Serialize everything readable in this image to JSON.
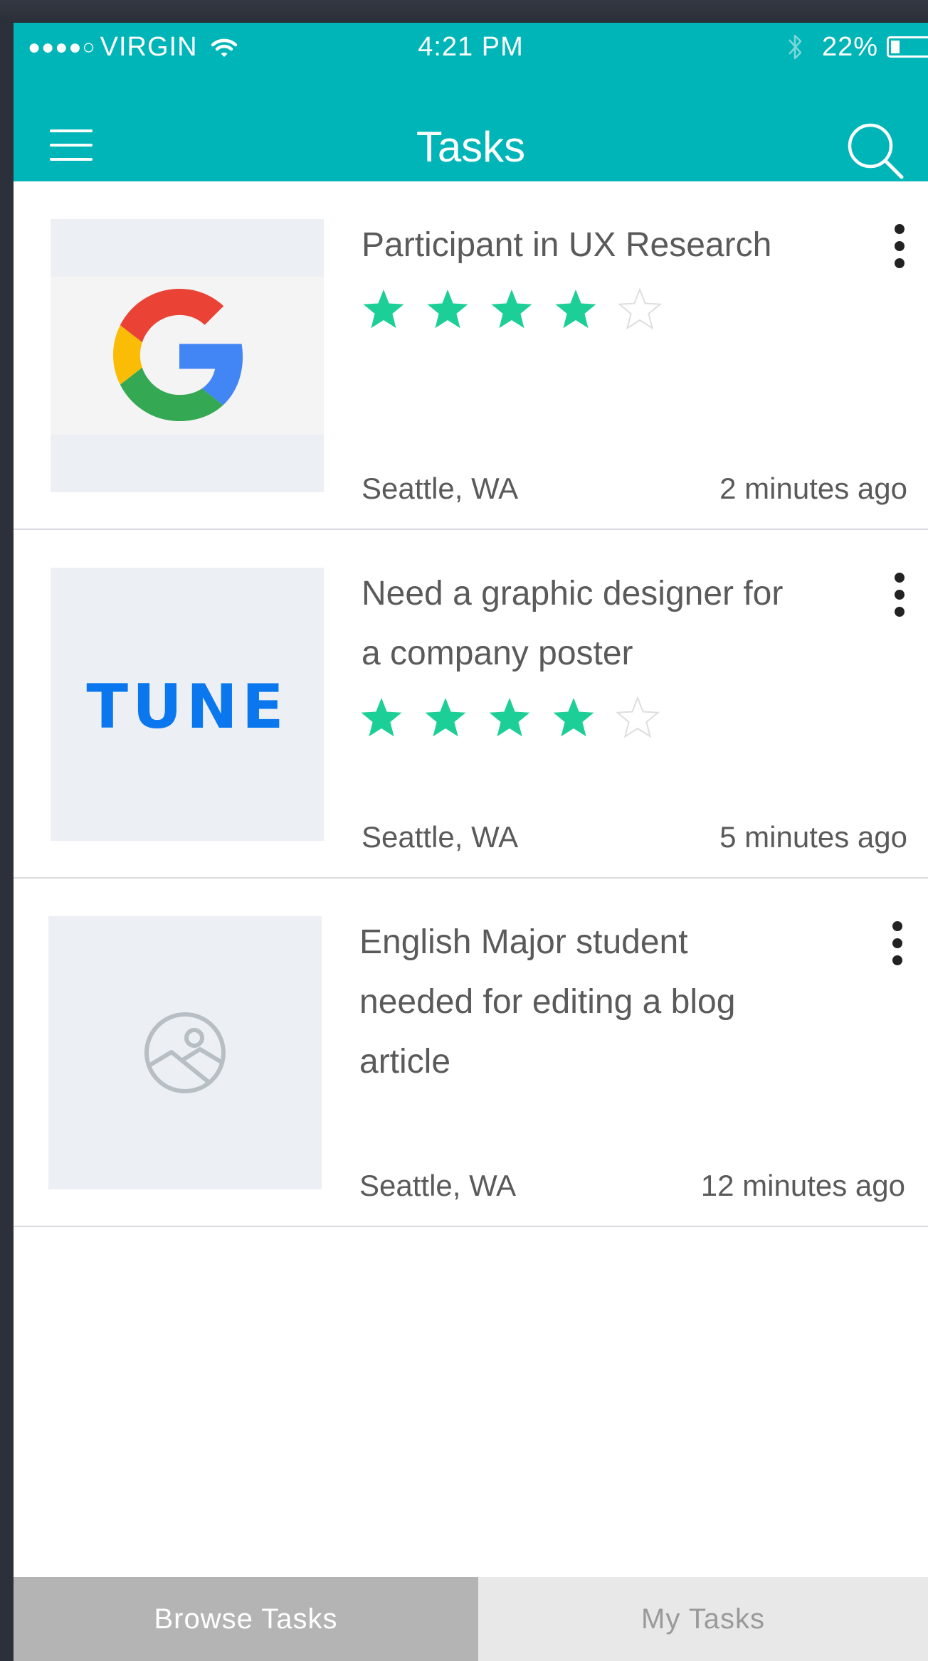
{
  "status_bar": {
    "signal": "●●●●○",
    "carrier": "VIRGIN",
    "time": "4:21 PM",
    "battery_percent": "22%",
    "battery_level": 0.22
  },
  "header": {
    "title": "Tasks"
  },
  "tasks": [
    {
      "title": "Participant in UX Research",
      "logo": "google-logo",
      "rating": 4,
      "rating_max": 5,
      "location": "Seattle, WA",
      "time_ago": "2 minutes ago"
    },
    {
      "title": "Need a graphic designer for a company poster",
      "logo": "tune-logo",
      "logo_text": "TUNE",
      "rating": 4,
      "rating_max": 5,
      "location": "Seattle, WA",
      "time_ago": "5 minutes ago"
    },
    {
      "title": "English Major student needed for editing a blog article",
      "logo": "image-placeholder-icon",
      "location": "Seattle, WA",
      "time_ago": "12 minutes ago"
    }
  ],
  "tabs": [
    {
      "label": "Browse Tasks",
      "active": true
    },
    {
      "label": "My Tasks",
      "active": false
    }
  ],
  "colors": {
    "header": "#00b5b8",
    "star_filled": "#1ccf97",
    "tab_active_bg": "#b4b4b4",
    "tab_inactive_bg": "#e8e8e8"
  }
}
